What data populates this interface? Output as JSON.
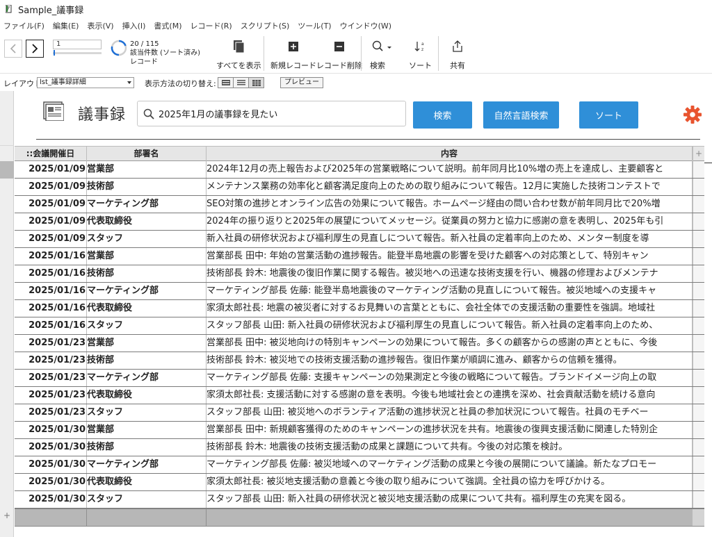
{
  "window": {
    "title": "Sample_議事録"
  },
  "menu": [
    "ファイル(F)",
    "編集(E)",
    "表示(V)",
    "挿入(I)",
    "書式(M)",
    "レコード(R)",
    "スクリプト(S)",
    "ツール(T)",
    "ウインドウ(W)"
  ],
  "toolbar": {
    "record_number": "1",
    "record_progress": 0.01,
    "found_count": "20 / 115",
    "found_label": "該当件数 (ソート済み)",
    "record_label": "レコード",
    "show_all": "すべてを表示",
    "new_record": "新規レコード",
    "delete_record": "レコード削除",
    "find": "検索",
    "sort": "ソート",
    "share": "共有"
  },
  "layoutbar": {
    "layout_label": "レイアウト:",
    "layout_value": "lst_議事録詳細",
    "view_label": "表示方法の切り替え:",
    "preview": "プレビュー"
  },
  "header": {
    "title": "議事録",
    "search_value": "2025年1月の議事録を見たい",
    "search_button": "検索",
    "nl_search_button": "自然言語検索",
    "sort_button": "ソート"
  },
  "table": {
    "columns": [
      "::会議開催日",
      "部署名",
      "内容"
    ],
    "add_column": "+",
    "rows": [
      {
        "date": "2025/01/09",
        "dept": "営業部",
        "content": "2024年12月の売上報告および2025年の営業戦略について説明。前年同月比10%増の売上を達成し、主要顧客と"
      },
      {
        "date": "2025/01/09",
        "dept": "技術部",
        "content": "メンテナンス業務の効率化と顧客満足度向上のための取り組みについて報告。12月に実施した技術コンテストで"
      },
      {
        "date": "2025/01/09",
        "dept": "マーケティング部",
        "content": "SEO対策の進捗とオンライン広告の効果について報告。ホームページ経由の問い合わせ数が前年同月比で20%増"
      },
      {
        "date": "2025/01/09",
        "dept": "代表取締役",
        "content": "2024年の振り返りと2025年の展望についてメッセージ。従業員の努力と協力に感謝の意を表明し、2025年も引"
      },
      {
        "date": "2025/01/09",
        "dept": "スタッフ",
        "content": "新入社員の研修状況および福利厚生の見直しについて報告。新入社員の定着率向上のため、メンター制度を導"
      },
      {
        "date": "2025/01/16",
        "dept": "営業部",
        "content": "営業部長 田中: 年始の営業活動の進捗報告。能登半島地震の影響を受けた顧客への対応策として、特別キャン"
      },
      {
        "date": "2025/01/16",
        "dept": "技術部",
        "content": "技術部長 鈴木: 地震後の復旧作業に関する報告。被災地への迅速な技術支援を行い、機器の修理およびメンテナ"
      },
      {
        "date": "2025/01/16",
        "dept": "マーケティング部",
        "content": "マーケティング部長 佐藤: 能登半島地震後のマーケティング活動の見直しについて報告。被災地域への支援キャ"
      },
      {
        "date": "2025/01/16",
        "dept": "代表取締役",
        "content": "家須太郎社長: 地震の被災者に対するお見舞いの言葉とともに、会社全体での支援活動の重要性を強調。地域社"
      },
      {
        "date": "2025/01/16",
        "dept": "スタッフ",
        "content": "スタッフ部長 山田: 新入社員の研修状況および福利厚生の見直しについて報告。新入社員の定着率向上のため、"
      },
      {
        "date": "2025/01/23",
        "dept": "営業部",
        "content": "営業部長 田中: 被災地向けの特別キャンペーンの効果について報告。多くの顧客からの感謝の声とともに、今後"
      },
      {
        "date": "2025/01/23",
        "dept": "技術部",
        "content": "技術部長 鈴木: 被災地での技術支援活動の進捗報告。復旧作業が順調に進み、顧客からの信頼を獲得。"
      },
      {
        "date": "2025/01/23",
        "dept": "マーケティング部",
        "content": "マーケティング部長 佐藤: 支援キャンペーンの効果測定と今後の戦略について報告。ブランドイメージ向上の取"
      },
      {
        "date": "2025/01/23",
        "dept": "代表取締役",
        "content": "家須太郎社長: 支援活動に対する感謝の意を表明。今後も地域社会との連携を深め、社会貢献活動を続ける意向"
      },
      {
        "date": "2025/01/23",
        "dept": "スタッフ",
        "content": "スタッフ部長 山田: 被災地へのボランティア活動の進捗状況と社員の参加状況について報告。社員のモチベー"
      },
      {
        "date": "2025/01/30",
        "dept": "営業部",
        "content": "営業部長 田中: 新規顧客獲得のためのキャンペーンの進捗状況を共有。地震後の復興支援活動に関連した特別企"
      },
      {
        "date": "2025/01/30",
        "dept": "技術部",
        "content": "技術部長 鈴木: 地震後の技術支援活動の成果と課題について共有。今後の対応策を検討。"
      },
      {
        "date": "2025/01/30",
        "dept": "マーケティング部",
        "content": "マーケティング部長 佐藤: 被災地域へのマーケティング活動の成果と今後の展開について議論。新たなプロモー"
      },
      {
        "date": "2025/01/30",
        "dept": "代表取締役",
        "content": "家須太郎社長: 被災地支援活動の意義と今後の取り組みについて強調。全社員の協力を呼びかける。"
      },
      {
        "date": "2025/01/30",
        "dept": "スタッフ",
        "content": "スタッフ部長 山田: 新入社員の研修状況と被災地支援活動の成果について共有。福利厚生の充実を図る。"
      }
    ]
  },
  "gutter": {
    "add_symbol": "+"
  },
  "colors": {
    "accent": "#2f8fd8",
    "gear": "#e8542f",
    "header_bg": "#e6e6e6",
    "footer_bg": "#b7b7b7"
  }
}
